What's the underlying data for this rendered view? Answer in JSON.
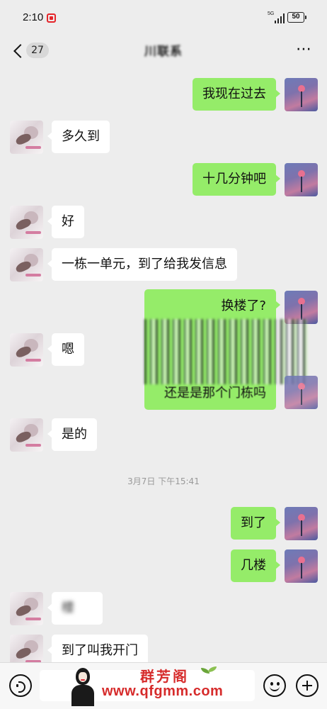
{
  "status_bar": {
    "time": "2:10",
    "network": "5G",
    "battery": "50"
  },
  "header": {
    "unread_count": "27",
    "title": "川联系"
  },
  "messages": [
    {
      "side": "self",
      "text": "我现在过去"
    },
    {
      "side": "other",
      "text": "多久到"
    },
    {
      "side": "self",
      "text": "十几分钟吧"
    },
    {
      "side": "other",
      "text": "好"
    },
    {
      "side": "other",
      "text": "一栋一单元，到了给我发信息"
    },
    {
      "side": "self",
      "text": "换楼了?",
      "continued": "还是是那个门栋吗"
    },
    {
      "side": "other",
      "text": "嗯"
    },
    {
      "side": "other",
      "text": "是的"
    },
    {
      "side": "self",
      "text": "到了"
    },
    {
      "side": "self",
      "text": "几楼"
    },
    {
      "side": "other",
      "text": "楼"
    },
    {
      "side": "other",
      "text": "到了叫我开门"
    }
  ],
  "timestamp": "3月7日 下午15:41",
  "watermark": {
    "brand": "群芳阁",
    "url": "www.qfgmm.com"
  },
  "colors": {
    "self_bubble": "#95ec69",
    "other_bubble": "#ffffff",
    "background": "#ededed"
  },
  "icons": [
    "back-icon",
    "more-icon",
    "voice-icon",
    "emoji-icon",
    "plus-icon"
  ]
}
